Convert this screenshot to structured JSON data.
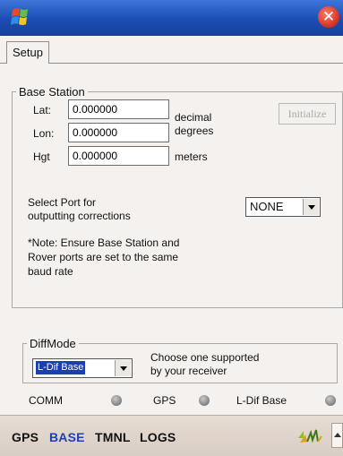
{
  "window": {
    "close_glyph": "✕"
  },
  "tabs": [
    {
      "label": "Setup"
    }
  ],
  "base_station": {
    "legend": "Base Station",
    "lat": {
      "label": "Lat:",
      "value": "0.000000"
    },
    "lon": {
      "label": "Lon:",
      "value": "0.000000"
    },
    "hgt": {
      "label": "Hgt",
      "value": "0.000000"
    },
    "units_decimal": "decimal",
    "units_degrees": "degrees",
    "units_meters": "meters",
    "initialize_label": "Initialize"
  },
  "port": {
    "label_line1": "Select Port for",
    "label_line2": "outputting corrections",
    "selected": "NONE"
  },
  "note": {
    "line1": "*Note: Ensure Base Station and",
    "line2": "Rover ports are set to the same",
    "line3": "baud rate"
  },
  "diffmode": {
    "legend": "DiffMode",
    "selected": "L-Dif Base",
    "hint_line1": "Choose one supported",
    "hint_line2": "by your receiver"
  },
  "status": [
    {
      "label": "COMM"
    },
    {
      "label": "GPS"
    },
    {
      "label": "L-Dif Base"
    }
  ],
  "bottom_nav": [
    {
      "label": "GPS",
      "color": "#111111"
    },
    {
      "label": "BASE",
      "color": "#1f3fb5"
    },
    {
      "label": "TMNL",
      "color": "#111111"
    },
    {
      "label": "LOGS",
      "color": "#111111"
    }
  ],
  "icons": {
    "start": "windows-flag-icon",
    "signal": "signal-strength-icon"
  }
}
